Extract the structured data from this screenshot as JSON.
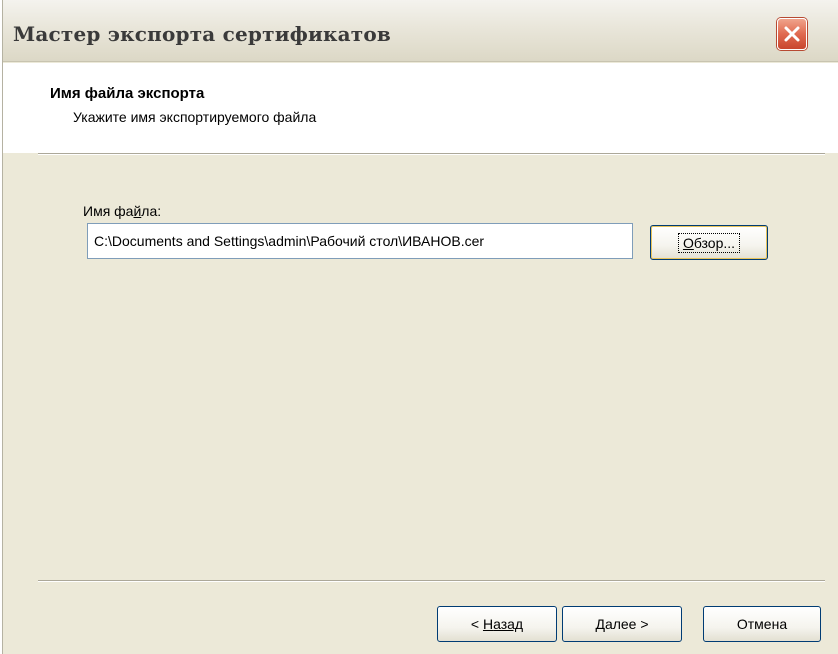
{
  "window": {
    "title": "Мастер экспорта сертификатов"
  },
  "header": {
    "title": "Имя файла экспорта",
    "subtitle": "Укажите имя экспортируемого файла"
  },
  "form": {
    "file_label_pre": "Имя фа",
    "file_label_accel": "й",
    "file_label_post": "ла:",
    "file_value": "C:\\Documents and Settings\\admin\\Рабочий стол\\ИВАНОВ.cer",
    "browse_accel": "О",
    "browse_rest": "бзор..."
  },
  "buttons": {
    "back_prefix": "< ",
    "back_accel": "Н",
    "back_rest": "азад",
    "next_accel": "Д",
    "next_rest": "алее >",
    "cancel": "Отмена"
  },
  "icons": {
    "close": "close-icon"
  }
}
